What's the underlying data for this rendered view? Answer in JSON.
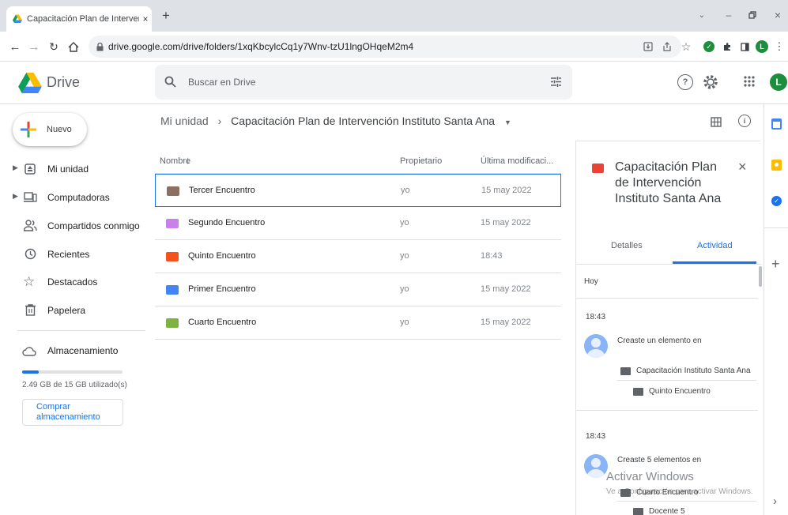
{
  "browser": {
    "tab_title": "Capacitación Plan de Intervenció",
    "tab_close": "×",
    "new_tab": "+",
    "url": "drive.google.com/drive/folders/1xqKbcylcCq1y7Wnv-tzU1lngOHqeM2m4",
    "profile_initial": "L"
  },
  "drive": {
    "product_name": "Drive",
    "search_placeholder": "Buscar en Drive",
    "profile_initial": "L",
    "new_button": "Nuevo",
    "nav_items": [
      {
        "label": "Mi unidad",
        "icon": "drive-icon"
      },
      {
        "label": "Computadoras",
        "icon": "computer-icon"
      },
      {
        "label": "Compartidos conmigo",
        "icon": "people-icon"
      },
      {
        "label": "Recientes",
        "icon": "clock-icon"
      },
      {
        "label": "Destacados",
        "icon": "star-icon"
      },
      {
        "label": "Papelera",
        "icon": "trash-icon"
      }
    ],
    "storage_label": "Almacenamiento",
    "storage_used_text": "2.49 GB de 15 GB utilizado(s)",
    "storage_used_fraction": 0.166,
    "buy_storage_line1": "Comprar",
    "buy_storage_line2": "almacenamiento"
  },
  "main": {
    "breadcrumb_root": "Mi unidad",
    "breadcrumb_separator": "›",
    "breadcrumb_current": "Capacitación Plan de Intervención Instituto Santa Ana",
    "columns": {
      "name": "Nombre",
      "owner": "Propietario",
      "modified": "Última modificaci..."
    },
    "rows": [
      {
        "name": "Tercer Encuentro",
        "owner": "yo",
        "modified": "15 may 2022",
        "color": "#8d6e63"
      },
      {
        "name": "Segundo Encuentro",
        "owner": "yo",
        "modified": "15 may 2022",
        "color": "#c980e8"
      },
      {
        "name": "Quinto Encuentro",
        "owner": "yo",
        "modified": "18:43",
        "color": "#f4511e"
      },
      {
        "name": "Primer Encuentro",
        "owner": "yo",
        "modified": "15 may 2022",
        "color": "#4285f4"
      },
      {
        "name": "Cuarto Encuentro",
        "owner": "yo",
        "modified": "15 may 2022",
        "color": "#7cb342"
      }
    ]
  },
  "panel": {
    "title_line1": "Capacitación Plan",
    "title_line2": "de Intervención",
    "title_line3": "Instituto Santa Ana",
    "close": "×",
    "tab_details": "Detalles",
    "tab_activity": "Actividad",
    "group_today": "Hoy",
    "activities": [
      {
        "time": "18:43",
        "text": "Creaste un elemento en",
        "folder": "Capacitación Instituto Santa Ana",
        "item": "Quinto Encuentro"
      },
      {
        "time": "18:43",
        "text": "Creaste 5 elementos en",
        "folder": "Cuarto Encuentro",
        "item": "Docente 5"
      }
    ]
  },
  "watermark": {
    "line1": "Activar Windows",
    "line2": "Ve a Configuración para activar Windows."
  },
  "colors": {
    "accent": "#1a73e8",
    "selected_border": "#1a73e8",
    "panel_folder": "#ea4335"
  }
}
